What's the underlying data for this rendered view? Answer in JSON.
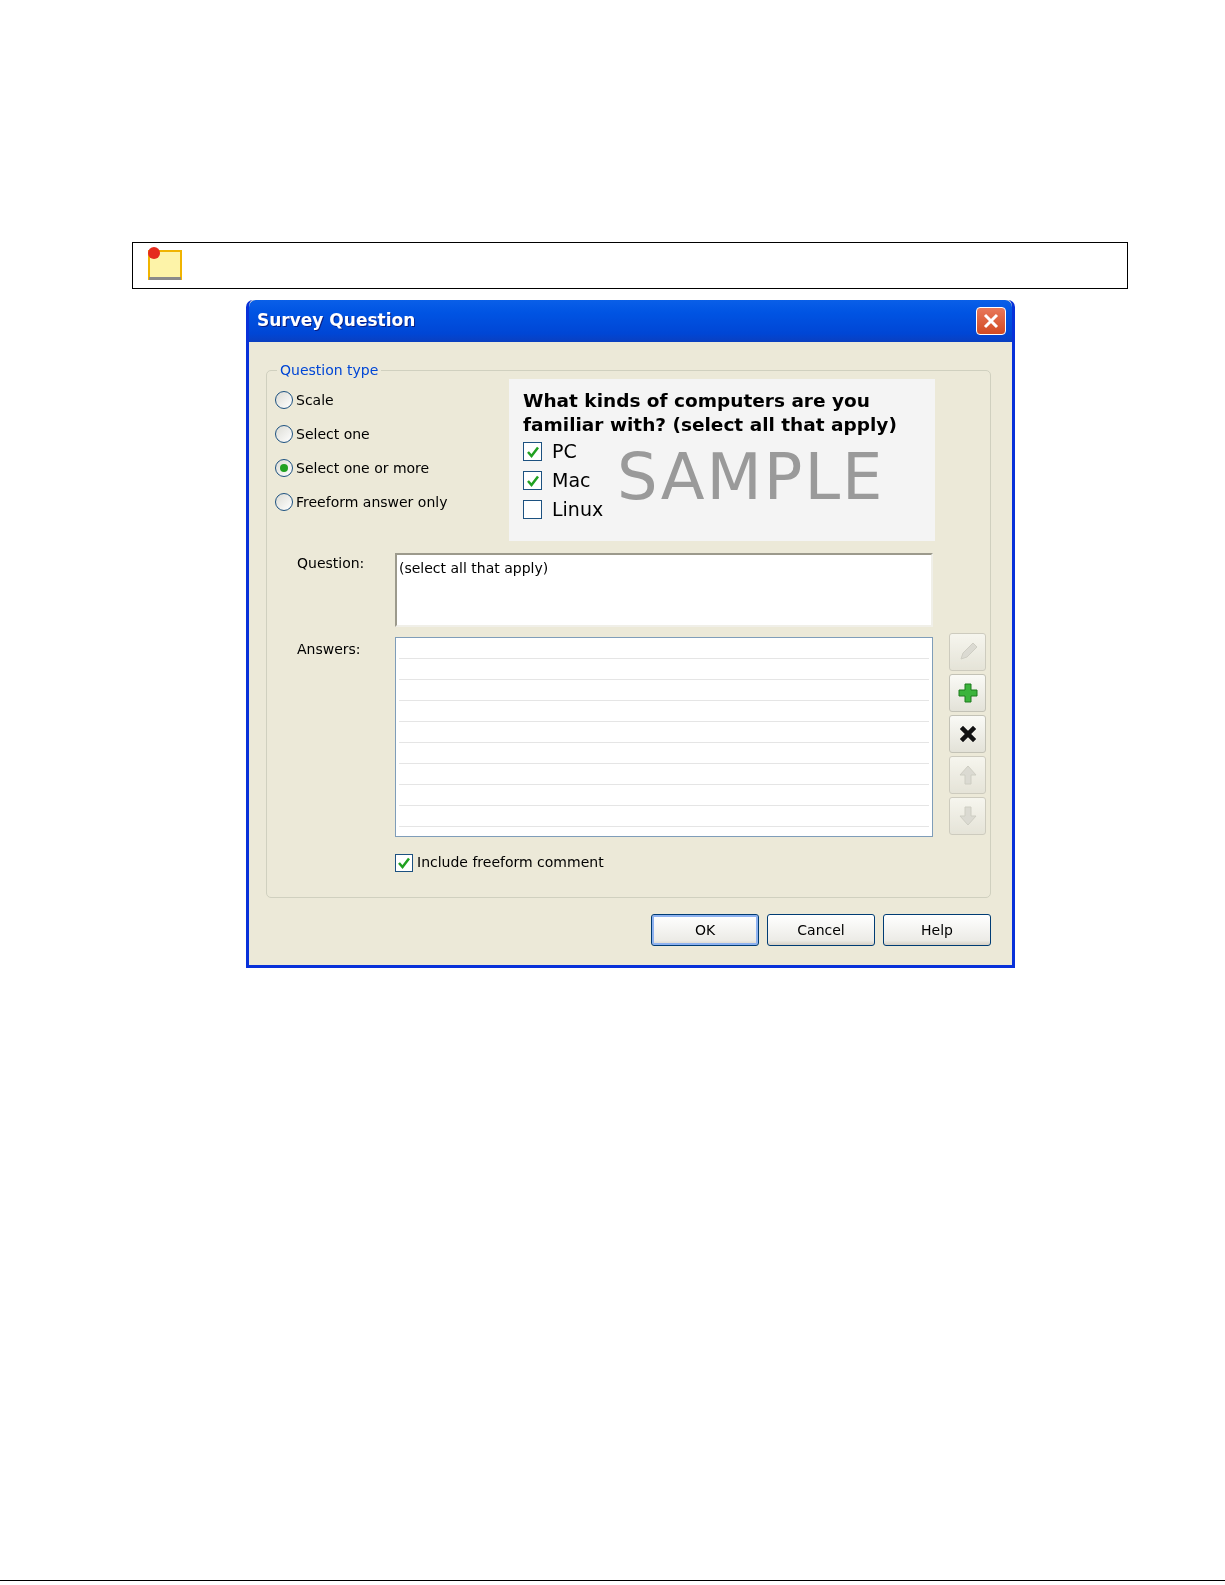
{
  "dialog": {
    "title": "Survey Question"
  },
  "question_type": {
    "legend": "Question type",
    "options": [
      {
        "label": "Scale",
        "selected": false
      },
      {
        "label": "Select one",
        "selected": false
      },
      {
        "label": "Select one or more",
        "selected": true
      },
      {
        "label": "Freeform answer only",
        "selected": false
      }
    ]
  },
  "preview": {
    "question": "What kinds of computers are you familiar with? (select all that apply)",
    "watermark": "SAMPLE",
    "choices": [
      {
        "label": "PC",
        "checked": true
      },
      {
        "label": "Mac",
        "checked": true
      },
      {
        "label": "Linux",
        "checked": false
      }
    ]
  },
  "question": {
    "label": "Question:",
    "value": "(select all that apply)"
  },
  "answers": {
    "label": "Answers:"
  },
  "tools": [
    {
      "kind": "edit",
      "disabled": true
    },
    {
      "kind": "add",
      "disabled": false
    },
    {
      "kind": "delete",
      "disabled": false
    },
    {
      "kind": "up",
      "disabled": true
    },
    {
      "kind": "down",
      "disabled": true
    }
  ],
  "include_comment": {
    "label": "Include freeform comment",
    "checked": true
  },
  "buttons": [
    {
      "label": "OK",
      "default": true
    },
    {
      "label": "Cancel",
      "default": false
    },
    {
      "label": "Help",
      "default": false
    }
  ]
}
